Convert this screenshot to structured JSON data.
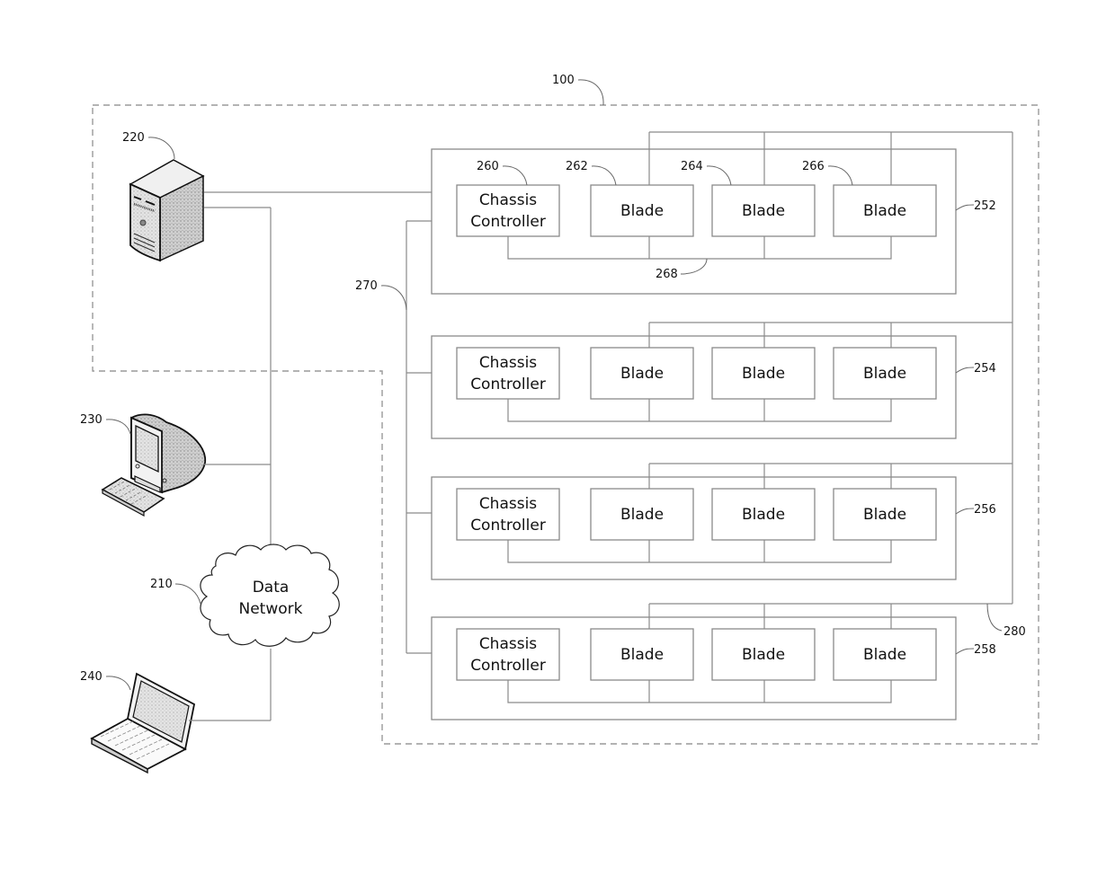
{
  "diagram": {
    "system_ref": "100",
    "network": {
      "ref": "210",
      "label_line1": "Data",
      "label_line2": "Network"
    },
    "server": {
      "ref": "220",
      "icon": "server-tower-icon"
    },
    "desktop": {
      "ref": "230",
      "icon": "desktop-computer-icon"
    },
    "laptop": {
      "ref": "240",
      "icon": "laptop-icon"
    },
    "management_network_ref": "270",
    "blade_network_ref": "280",
    "chassis_bus_ref": "268",
    "chassis": [
      {
        "ref": "252",
        "controller": {
          "ref": "260",
          "line1": "Chassis",
          "line2": "Controller"
        },
        "blades": [
          {
            "ref": "262",
            "label": "Blade"
          },
          {
            "ref": "264",
            "label": "Blade"
          },
          {
            "ref": "266",
            "label": "Blade"
          }
        ]
      },
      {
        "ref": "254",
        "controller": {
          "line1": "Chassis",
          "line2": "Controller"
        },
        "blades": [
          {
            "label": "Blade"
          },
          {
            "label": "Blade"
          },
          {
            "label": "Blade"
          }
        ]
      },
      {
        "ref": "256",
        "controller": {
          "line1": "Chassis",
          "line2": "Controller"
        },
        "blades": [
          {
            "label": "Blade"
          },
          {
            "label": "Blade"
          },
          {
            "label": "Blade"
          }
        ]
      },
      {
        "ref": "258",
        "controller": {
          "line1": "Chassis",
          "line2": "Controller"
        },
        "blades": [
          {
            "label": "Blade"
          },
          {
            "label": "Blade"
          },
          {
            "label": "Blade"
          }
        ]
      }
    ]
  }
}
